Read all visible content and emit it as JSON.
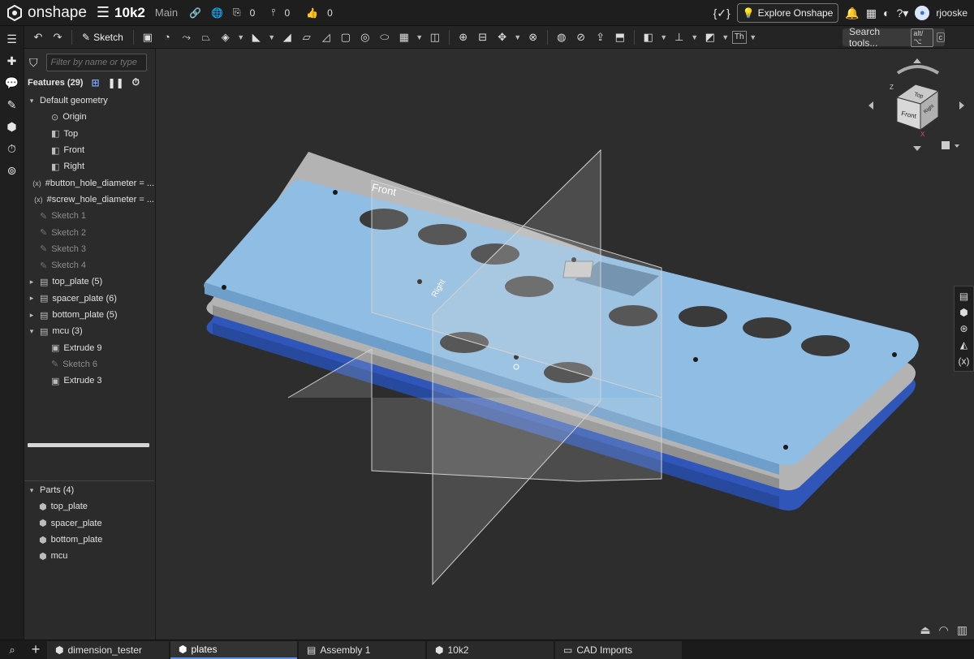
{
  "header": {
    "logo_text": "onshape",
    "doc_name": "10k2",
    "branch": "Main",
    "versions_count": "0",
    "branches_count": "0",
    "likes_count": "0",
    "explore_label": "Explore Onshape",
    "user": "rjooske"
  },
  "toolbar": {
    "sketch_label": "Sketch",
    "search_label": "Search tools...",
    "search_shortcut_1": "alt/⌥",
    "search_shortcut_2": "c",
    "text_tool": "Th"
  },
  "feature_panel": {
    "filter_placeholder": "Filter by name or type",
    "features_title": "Features (29)",
    "items": [
      {
        "label": "Default geometry",
        "caret": "▾",
        "indent": 0,
        "icon": "none",
        "dim": false
      },
      {
        "label": "Origin",
        "caret": "",
        "indent": 1,
        "icon": "origin-icon",
        "dim": false
      },
      {
        "label": "Top",
        "caret": "",
        "indent": 1,
        "icon": "plane-icon",
        "dim": false
      },
      {
        "label": "Front",
        "caret": "",
        "indent": 1,
        "icon": "plane-icon",
        "dim": false
      },
      {
        "label": "Right",
        "caret": "",
        "indent": 1,
        "icon": "plane-icon",
        "dim": false
      },
      {
        "label": "#button_hole_diameter = ...",
        "caret": "",
        "indent": 0,
        "icon": "variable-icon",
        "dim": false
      },
      {
        "label": "#screw_hole_diameter = ...",
        "caret": "",
        "indent": 0,
        "icon": "variable-icon",
        "dim": false
      },
      {
        "label": "Sketch 1",
        "caret": "",
        "indent": 0,
        "icon": "sketch-icon",
        "dim": true
      },
      {
        "label": "Sketch 2",
        "caret": "",
        "indent": 0,
        "icon": "sketch-icon",
        "dim": true
      },
      {
        "label": "Sketch 3",
        "caret": "",
        "indent": 0,
        "icon": "sketch-icon",
        "dim": true
      },
      {
        "label": "Sketch 4",
        "caret": "",
        "indent": 0,
        "icon": "sketch-icon",
        "dim": true
      },
      {
        "label": "top_plate (5)",
        "caret": "▸",
        "indent": 0,
        "icon": "folder-icon",
        "dim": false
      },
      {
        "label": "spacer_plate (6)",
        "caret": "▸",
        "indent": 0,
        "icon": "folder-icon",
        "dim": false
      },
      {
        "label": "bottom_plate (5)",
        "caret": "▸",
        "indent": 0,
        "icon": "folder-icon",
        "dim": false
      },
      {
        "label": "mcu (3)",
        "caret": "▾",
        "indent": 0,
        "icon": "folder-icon",
        "dim": false
      },
      {
        "label": "Extrude 9",
        "caret": "",
        "indent": 1,
        "icon": "extrude-icon",
        "dim": false
      },
      {
        "label": "Sketch 6",
        "caret": "",
        "indent": 1,
        "icon": "sketch-icon",
        "dim": true
      },
      {
        "label": "Extrude 3",
        "caret": "",
        "indent": 1,
        "icon": "extrude-icon",
        "dim": false
      }
    ],
    "parts_title": "Parts (4)",
    "parts": [
      "top_plate",
      "spacer_plate",
      "bottom_plate",
      "mcu"
    ]
  },
  "viewport": {
    "plane_front_label": "Front",
    "plane_right_label": "Right",
    "colors": {
      "top_plate": "#8fbde3",
      "spacer_plate": "#a8a8a8",
      "bottom_plate": "#2f56b8"
    }
  },
  "viewcube": {
    "front": "Front",
    "top": "Top",
    "right": "Right",
    "axis_x": "X",
    "axis_y": "Y",
    "axis_z": "Z"
  },
  "tabs": [
    {
      "label": "dimension_tester",
      "active": false
    },
    {
      "label": "plates",
      "active": true
    },
    {
      "label": "Assembly 1",
      "active": false
    },
    {
      "label": "10k2",
      "active": false
    },
    {
      "label": "CAD Imports",
      "active": false
    }
  ]
}
